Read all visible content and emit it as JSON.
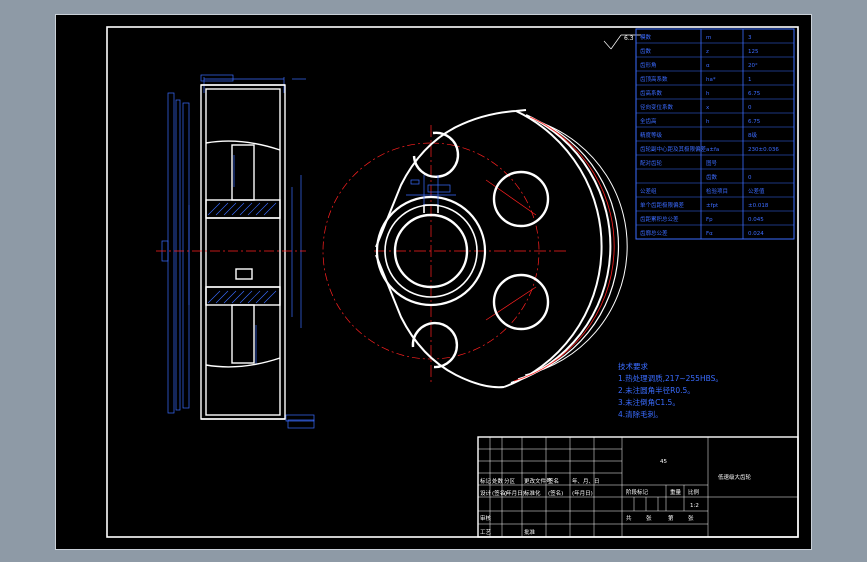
{
  "drawing_title": "低速级大齿轮",
  "title_block": {
    "scale": "1:2",
    "material_mark": "45",
    "rows": [
      {
        "cells": [
          "标记",
          "处数",
          "分区",
          "更改文件号",
          "签名",
          "年、月、日"
        ]
      },
      {
        "cells": [
          "设计",
          "(签名)",
          "(年月日)",
          "标准化",
          "(签名)",
          "(年月日)"
        ]
      },
      {
        "cells": [
          "审核",
          "",
          "",
          "",
          "",
          ""
        ]
      },
      {
        "cells": [
          "工艺",
          "",
          "",
          "批准",
          "",
          ""
        ]
      }
    ],
    "right_headers": [
      "阶段标记",
      "重量",
      "比例"
    ],
    "sheet_labels": [
      "共",
      "张",
      "第",
      "张"
    ]
  },
  "tech_requirements": {
    "heading": "技术要求",
    "items": [
      "1.热处理调质,217~255HBS。",
      "2.未注圆角半径R0.5。",
      "3.未注倒角C1.5。",
      "4.清除毛刺。"
    ]
  },
  "param_table": {
    "rows": [
      {
        "name": "模数",
        "sym": "m",
        "val": "3"
      },
      {
        "name": "齿数",
        "sym": "z",
        "val": "125"
      },
      {
        "name": "齿形角",
        "sym": "α",
        "val": "20°"
      },
      {
        "name": "齿顶高系数",
        "sym": "ha*",
        "val": "1"
      },
      {
        "name": "齿高系数",
        "sym": "h",
        "val": "6.75"
      },
      {
        "name": "径向变位系数",
        "sym": "x",
        "val": "0"
      },
      {
        "name": "全齿高",
        "sym": "h",
        "val": "6.75"
      },
      {
        "name": "精度等级",
        "sym": "",
        "val": "8级"
      },
      {
        "name": "齿轮副中心距及其极限偏差",
        "sym": "a±fa",
        "val": "230±0.036"
      },
      {
        "name": "配对齿轮",
        "sym": "图号",
        "val": ""
      },
      {
        "name": "",
        "sym": "齿数",
        "val": "0"
      },
      {
        "name": "公差组",
        "sym": "检验项目",
        "val": "公差值"
      },
      {
        "name": "单个齿距极限偏差",
        "sym": "±fpt",
        "val": "±0.018"
      },
      {
        "name": "齿距累积总公差",
        "sym": "Fp",
        "val": "0.045"
      },
      {
        "name": "齿廓总公差",
        "sym": "Fα",
        "val": "0.024"
      }
    ]
  },
  "roughness_top": "6.3",
  "colors": {
    "line": "#ffffff",
    "center": "#ff2020",
    "dim": "#3a6cff",
    "hatch": "#3a6cff"
  }
}
